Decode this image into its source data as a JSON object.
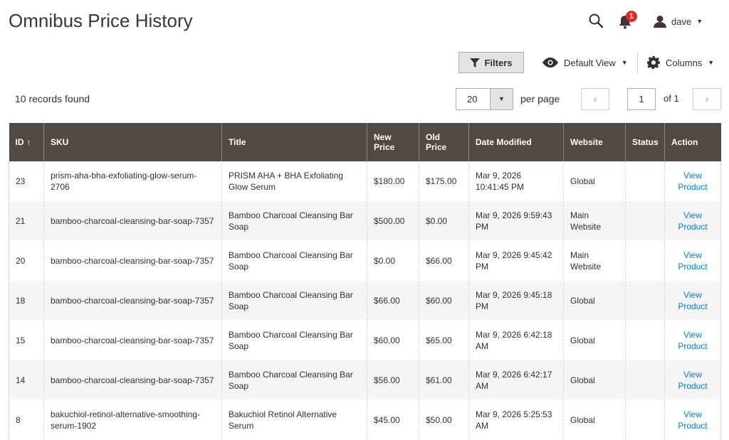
{
  "header": {
    "title": "Omnibus Price History",
    "notification_count": "1",
    "user_name": "dave"
  },
  "toolbar": {
    "filters_label": "Filters",
    "view_label": "Default View",
    "columns_label": "Columns"
  },
  "pager": {
    "records_found": "10 records found",
    "per_page_value": "20",
    "per_page_label": "per page",
    "current_page": "1",
    "of_pages": "of 1"
  },
  "grid": {
    "sort_indicator": "↑",
    "columns": [
      "ID",
      "SKU",
      "Title",
      "New Price",
      "Old Price",
      "Date Modified",
      "Website",
      "Status",
      "Action"
    ],
    "rows": [
      {
        "id": "23",
        "sku": "prism-aha-bha-exfoliating-glow-serum-2706",
        "title": "PRISM AHA + BHA Exfoliating Glow Serum",
        "new_price": "$180.00",
        "old_price": "$175.00",
        "date": "Mar 9, 2026 10:41:45 PM",
        "website": "Global",
        "status": "",
        "action": "View Product"
      },
      {
        "id": "21",
        "sku": "bamboo-charcoal-cleansing-bar-soap-7357",
        "title": "Bamboo Charcoal Cleansing Bar Soap",
        "new_price": "$500.00",
        "old_price": "$0.00",
        "date": "Mar 9, 2026 9:59:43 PM",
        "website": "Main Website",
        "status": "",
        "action": "View Product"
      },
      {
        "id": "20",
        "sku": "bamboo-charcoal-cleansing-bar-soap-7357",
        "title": "Bamboo Charcoal Cleansing Bar Soap",
        "new_price": "$0.00",
        "old_price": "$66.00",
        "date": "Mar 9, 2026 9:45:42 PM",
        "website": "Main Website",
        "status": "",
        "action": "View Product"
      },
      {
        "id": "18",
        "sku": "bamboo-charcoal-cleansing-bar-soap-7357",
        "title": "Bamboo Charcoal Cleansing Bar Soap",
        "new_price": "$66.00",
        "old_price": "$60.00",
        "date": "Mar 9, 2026 9:45:18 PM",
        "website": "Global",
        "status": "",
        "action": "View Product"
      },
      {
        "id": "15",
        "sku": "bamboo-charcoal-cleansing-bar-soap-7357",
        "title": "Bamboo Charcoal Cleansing Bar Soap",
        "new_price": "$60.00",
        "old_price": "$65.00",
        "date": "Mar 9, 2026 6:42:18 AM",
        "website": "Global",
        "status": "",
        "action": "View Product"
      },
      {
        "id": "14",
        "sku": "bamboo-charcoal-cleansing-bar-soap-7357",
        "title": "Bamboo Charcoal Cleansing Bar Soap",
        "new_price": "$56.00",
        "old_price": "$61.00",
        "date": "Mar 9, 2026 6:42:17 AM",
        "website": "Global",
        "status": "",
        "action": "View Product"
      },
      {
        "id": "8",
        "sku": "bakuchiol-retinol-alternative-smoothing-serum-1902",
        "title": "Bakuchiol Retinol Alternative Serum",
        "new_price": "$45.00",
        "old_price": "$50.00",
        "date": "Mar 9, 2026 5:25:53 AM",
        "website": "Global",
        "status": "",
        "action": "View Product"
      }
    ]
  },
  "colors": {
    "header_bg": "#514943",
    "link": "#007bdb",
    "badge": "#e22626"
  },
  "icons": [
    "search-icon",
    "bell-icon",
    "user-icon",
    "filter-icon",
    "eye-icon",
    "gear-icon"
  ]
}
